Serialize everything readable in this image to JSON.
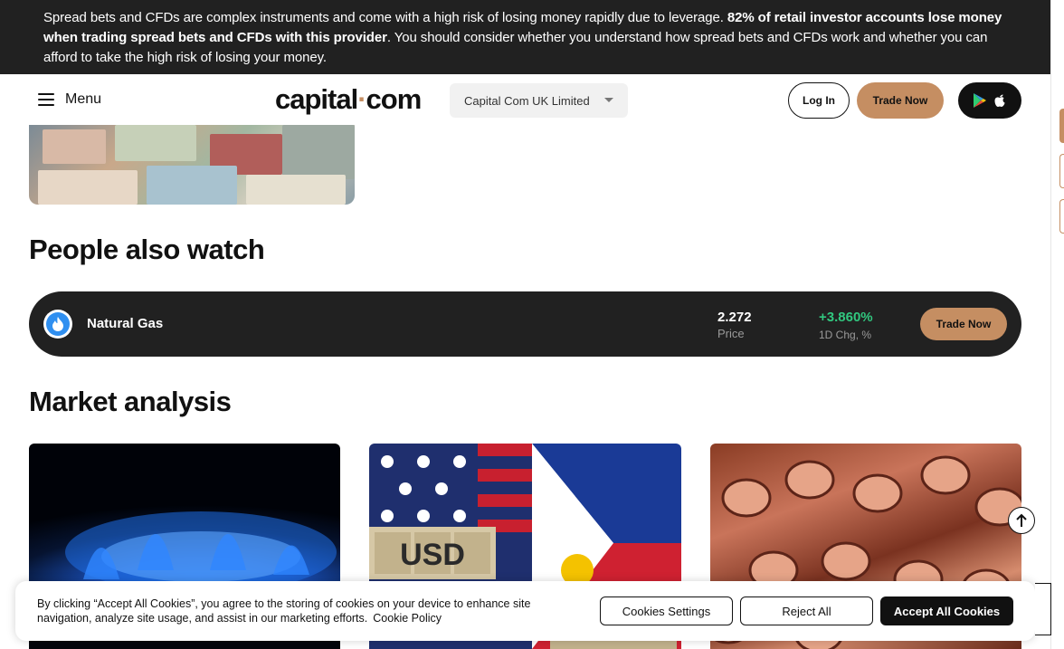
{
  "risk_banner": {
    "text_before": "Spread bets and CFDs are complex instruments and come with a high risk of losing money rapidly due to leverage. ",
    "text_bold": "82% of retail investor accounts lose money when trading spread bets and CFDs with this provider",
    "text_after": ". You should consider whether you understand how spread bets and CFDs work and whether you can afford to take the high risk of losing your money."
  },
  "header": {
    "menu_label": "Menu",
    "logo_left": "capital",
    "logo_dot": "·",
    "logo_right": "com",
    "entity_select": "Capital Com UK Limited",
    "login_label": "Log In",
    "trade_label": "Trade Now"
  },
  "people_also_watch": {
    "heading": "People also watch",
    "items": [
      {
        "name": "Natural Gas",
        "price": "2.272",
        "price_label": "Price",
        "change": "+3.860%",
        "change_label": "1D Chg, %",
        "trade_label": "Trade Now"
      }
    ]
  },
  "market_analysis": {
    "heading": "Market analysis",
    "card_image_text": "USD"
  },
  "cookie_banner": {
    "text": "By clicking “Accept All Cookies”, you agree to the storing of cookies on your device to enhance site navigation, analyze site usage, and assist in our marketing efforts.",
    "policy_link": "Cookie Policy",
    "settings_label": "Cookies Settings",
    "reject_label": "Reject All",
    "accept_label": "Accept All Cookies"
  },
  "colors": {
    "accent": "#c58e62",
    "dark": "#212121",
    "positive": "#31c77f"
  }
}
